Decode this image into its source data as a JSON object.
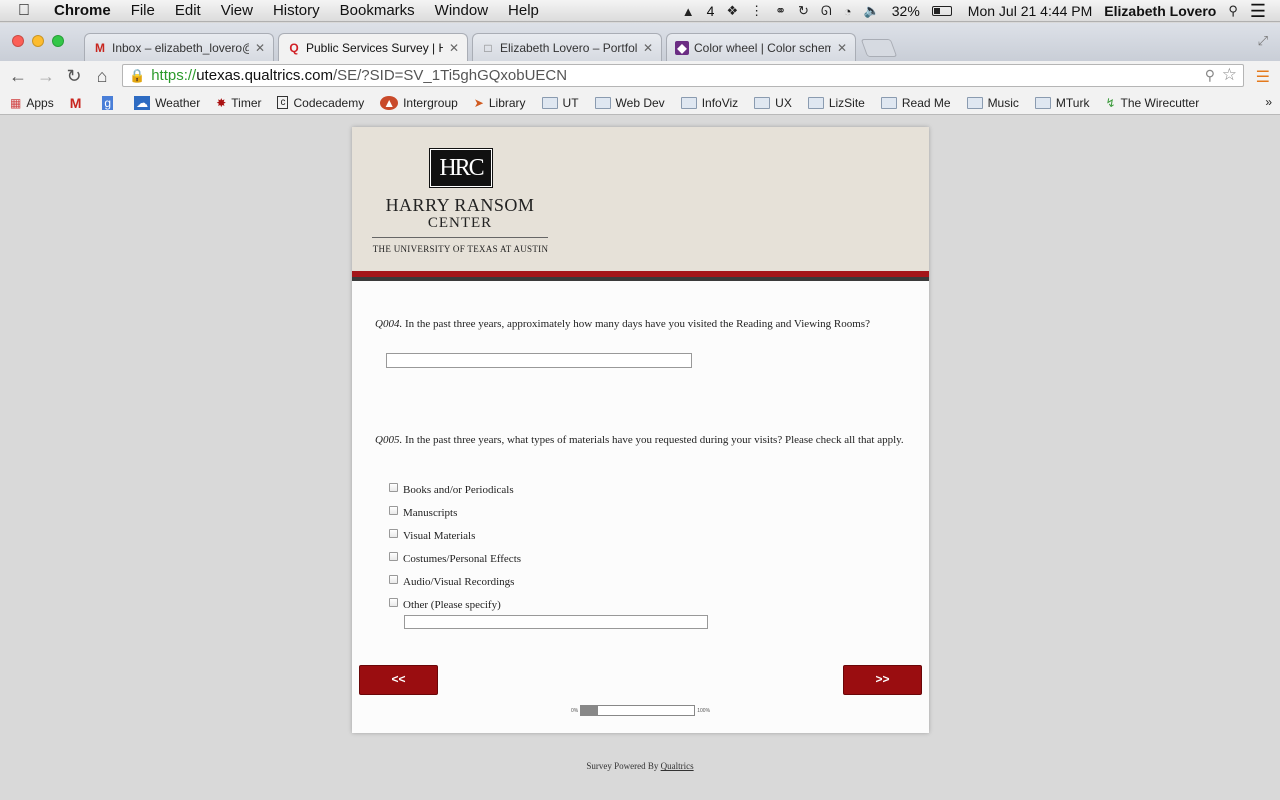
{
  "menubar": {
    "app": "Chrome",
    "items": [
      "File",
      "Edit",
      "View",
      "History",
      "Bookmarks",
      "Window",
      "Help"
    ],
    "status": {
      "adobe_count": "4",
      "battery": "32%",
      "datetime": "Mon Jul 21  4:44 PM",
      "user": "Elizabeth Lovero"
    }
  },
  "tabs": [
    {
      "title": "Inbox – elizabeth_lovero@",
      "favicon": "gmail-icon",
      "active": false
    },
    {
      "title": "Public Services Survey | Ha",
      "favicon": "qualtrics-icon",
      "active": true
    },
    {
      "title": "Elizabeth Lovero – Portfolio",
      "favicon": "page-icon",
      "active": false
    },
    {
      "title": "Color wheel | Color scheme",
      "favicon": "adobe-color-icon",
      "active": false
    }
  ],
  "address": {
    "protocol": "https://",
    "host": "utexas.qualtrics.com",
    "path": "/SE/?SID=SV_1Ti5ghGQxobUECN"
  },
  "bookmarks": [
    {
      "label": "Apps",
      "icon": "apps-grid-icon"
    },
    {
      "label": "",
      "icon": "gmail-icon"
    },
    {
      "label": "",
      "icon": "google-drive-icon"
    },
    {
      "label": "Weather",
      "icon": "weather-icon"
    },
    {
      "label": "Timer",
      "icon": "timer-icon"
    },
    {
      "label": "Codecademy",
      "icon": "codecademy-icon"
    },
    {
      "label": "Intergroup",
      "icon": "intergroup-icon"
    },
    {
      "label": "Library",
      "icon": "library-icon"
    },
    {
      "label": "UT",
      "icon": "folder-icon"
    },
    {
      "label": "Web Dev",
      "icon": "folder-icon"
    },
    {
      "label": "InfoViz",
      "icon": "folder-icon"
    },
    {
      "label": "UX",
      "icon": "folder-icon"
    },
    {
      "label": "LizSite",
      "icon": "folder-icon"
    },
    {
      "label": "Read Me",
      "icon": "folder-icon"
    },
    {
      "label": "Music",
      "icon": "folder-icon"
    },
    {
      "label": "MTurk",
      "icon": "folder-icon"
    },
    {
      "label": "The Wirecutter",
      "icon": "wirecutter-icon"
    }
  ],
  "bookmarks_more": "»",
  "header": {
    "logo_mark": "HRC",
    "name": "HARRY RANSOM",
    "sub": "CENTER",
    "university": "THE UNIVERSITY OF TEXAS AT AUSTIN"
  },
  "q004": {
    "number": "Q004.",
    "text": " In the past three years, approximately how many days have you visited the Reading and Viewing Rooms?",
    "value": ""
  },
  "q005": {
    "number": "Q005.",
    "text": " In the past three years, what types of materials have you requested during your visits?   Please check all that apply.",
    "choices": [
      {
        "label": "Books and/or Periodicals",
        "checked": false
      },
      {
        "label": "Manuscripts",
        "checked": false
      },
      {
        "label": "Visual Materials",
        "checked": false
      },
      {
        "label": "Costumes/Personal Effects",
        "checked": false
      },
      {
        "label": "Audio/Visual Recordings",
        "checked": false
      },
      {
        "label": "Other (Please specify)",
        "checked": false
      }
    ],
    "other_value": ""
  },
  "nav": {
    "back_label": "<<",
    "next_label": ">>"
  },
  "progress": {
    "min_label": "0%",
    "max_label": "100%",
    "fraction": 0.15
  },
  "footer": {
    "prefix": "Survey Powered By ",
    "link": "Qualtrics"
  },
  "colors": {
    "accent_red": "#9a0d10",
    "banner": "#e6e1d8",
    "url_green": "#2a9a2a"
  }
}
